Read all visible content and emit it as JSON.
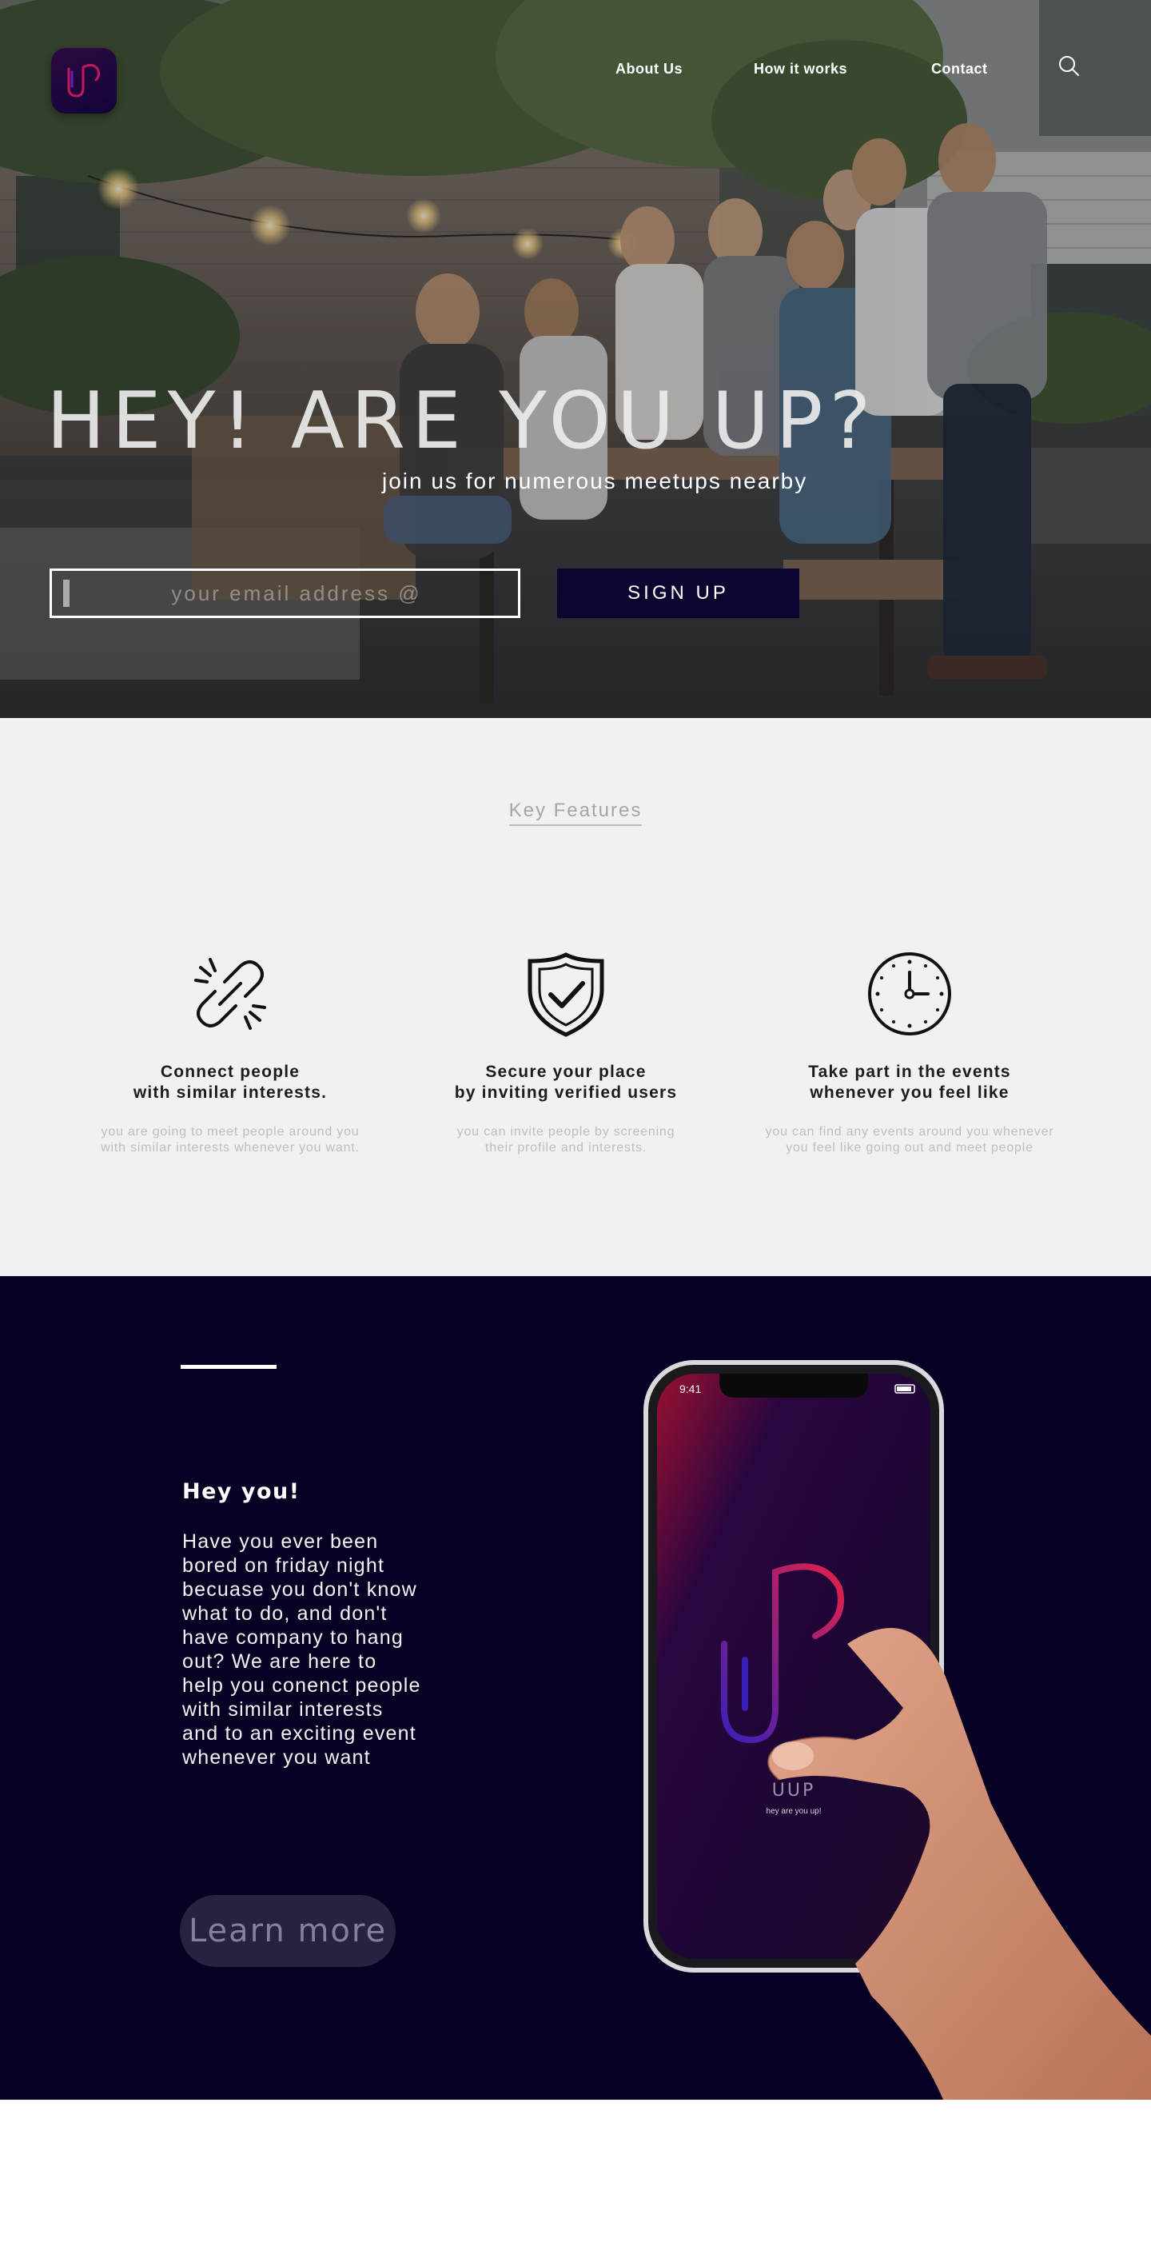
{
  "brand": {
    "accent": "#c2185b",
    "navy": "#0c0530",
    "dark_bg": "#060022"
  },
  "nav": {
    "links": [
      "About Us",
      "How it works",
      "Contact"
    ],
    "search_icon": "search-icon"
  },
  "hero": {
    "title": "HEY! ARE YOU UP?",
    "subtitle": "join us for numerous meetups nearby",
    "email_placeholder": "your email address @",
    "email_value": "",
    "signup_label": "SIGN UP"
  },
  "features": {
    "heading": "Key Features",
    "items": [
      {
        "icon": "link-icon",
        "title": "Connect people\nwith similar interests.",
        "desc": "you are going to meet people around you\nwith similar interests whenever you want."
      },
      {
        "icon": "shield-check-icon",
        "title": "Secure your place\nby inviting verified users",
        "desc": "you can invite people by screening\ntheir profile and interests."
      },
      {
        "icon": "clock-icon",
        "title": "Take part in the events\nwhenever you feel like",
        "desc": "you can find any events around you whenever\nyou feel like going out and meet people"
      }
    ]
  },
  "promo": {
    "heading": "Hey you!",
    "body": "Have you ever been bored on friday night becuase you don't know what to do, and don't have company to hang out? We are here to help you conenct people with similar interests and to an exciting event whenever you want",
    "button_label": "Learn more"
  },
  "phone": {
    "time": "9:41",
    "app_name": "UUP",
    "tagline": "hey are you up!"
  }
}
